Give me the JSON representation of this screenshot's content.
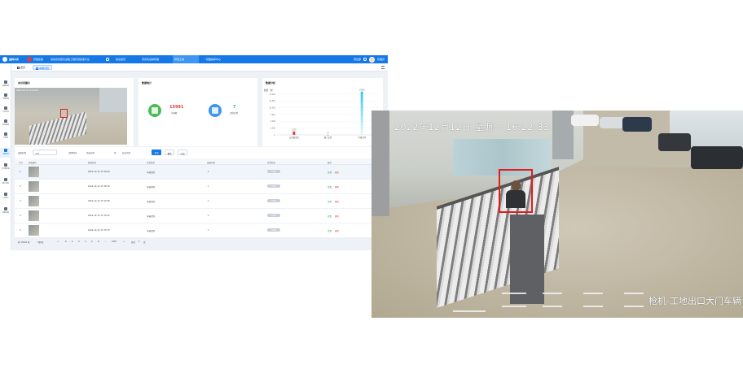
{
  "header": {
    "brand_primary": "国网水务",
    "brand_secondary": "智能建造",
    "system_title": "某综合管廊及道路工程智慧建造平台",
    "nav": [
      {
        "label": "综合首页",
        "active": false
      },
      {
        "label": "劳务实名制管理",
        "active": false
      },
      {
        "label": "智慧工地",
        "active": true
      },
      {
        "label": "一张图指挥中心",
        "active": false
      }
    ],
    "org": "项目部",
    "user": "管理员"
  },
  "tabs": [
    {
      "label": "首页",
      "active": false
    },
    {
      "label": "车辆识别",
      "active": true
    }
  ],
  "sidebar": [
    {
      "label": "视频监控",
      "active": false
    },
    {
      "label": "环境监测",
      "active": false
    },
    {
      "label": "人员定位",
      "active": false
    },
    {
      "label": "塔吊监测",
      "active": false
    },
    {
      "label": "升降机",
      "active": false
    },
    {
      "label": "车辆识别",
      "active": true
    },
    {
      "label": "安全帽识别",
      "active": false
    },
    {
      "label": "烟火识别",
      "active": false
    },
    {
      "label": "人员闯入",
      "active": false
    },
    {
      "label": "系统设置",
      "active": false
    }
  ],
  "capture_card": {
    "title": "未识别图片",
    "overlay": "2022-12-12 17:40:09"
  },
  "stats_card": {
    "title": "数据统计",
    "items": [
      {
        "icon": "stat-car-icon",
        "value": "15991",
        "label": "车辆数",
        "color": "#4cbb55",
        "value_color": "#e23d3d"
      },
      {
        "icon": "stat-alert-icon",
        "value": "7",
        "label": "识别告警",
        "color": "#3d95f0",
        "value_color": "#2bb3a0"
      }
    ]
  },
  "chart_card": {
    "title": "数据分析",
    "chart_data": {
      "type": "bar",
      "ylabel": "数量（次）",
      "yticks": [
        "15,000",
        "12,500",
        "10,000",
        "7,500",
        "5,000",
        "2,500",
        "0"
      ],
      "ylim": [
        0,
        15000
      ],
      "categories": [
        "安全帽识别",
        "烟火识别",
        "车辆识别"
      ],
      "values": [
        1278,
        17,
        15991
      ],
      "value_labels": [
        "1278",
        "17",
        "15991"
      ],
      "colors": [
        "#e23d3d",
        "#7f7f7f",
        "#38c8f0"
      ]
    }
  },
  "filters": {
    "label1": "设备名称",
    "select1": "全部",
    "label2": "识别时间",
    "date_start": "开始日期",
    "date_sep": "至",
    "date_end": "结束日期",
    "search_btn": "查询",
    "reset_btn": "重置",
    "export_btn": "导出"
  },
  "table": {
    "headers": [
      "序号",
      "抓拍图片",
      "抓拍时间",
      "告警类型",
      "设备名称",
      "告警状态",
      "操作"
    ],
    "rows": [
      {
        "idx": "1",
        "time": "2022-12-12 17:40:09",
        "type": "车辆识别",
        "device": "1",
        "status": "已处理",
        "view": "查看",
        "del": "删除",
        "selected": true
      },
      {
        "idx": "2",
        "time": "2022-12-12 17:38:16",
        "type": "车辆识别",
        "device": "1",
        "status": "已处理",
        "view": "查看",
        "del": "删除",
        "selected": false
      },
      {
        "idx": "3",
        "time": "2022-12-12 17:32:08",
        "type": "车辆识别",
        "device": "1",
        "status": "已处理",
        "view": "查看",
        "del": "删除",
        "selected": false
      },
      {
        "idx": "4",
        "time": "2022-12-12 17:30:41",
        "type": "车辆识别",
        "device": "1",
        "status": "已处理",
        "view": "查看",
        "del": "删除",
        "selected": false
      },
      {
        "idx": "5",
        "time": "2022-12-12 17:25:33",
        "type": "车辆识别",
        "device": "1",
        "status": "已处理",
        "view": "查看",
        "del": "删除",
        "selected": false
      }
    ]
  },
  "pager": {
    "total": "共 15991 条",
    "size": "5条/页",
    "prev": "<",
    "pages": [
      "1",
      "2",
      "3",
      "4",
      "5",
      "6",
      "...",
      "1567"
    ],
    "current": "1",
    "next": ">",
    "goto": "前往",
    "goto_value": "1",
    "page_unit": "页"
  },
  "capture_large": {
    "timestamp": "2022年12月12日 星期一 16:22:33",
    "camera_label": "枪机-工地出口大门车辆"
  }
}
